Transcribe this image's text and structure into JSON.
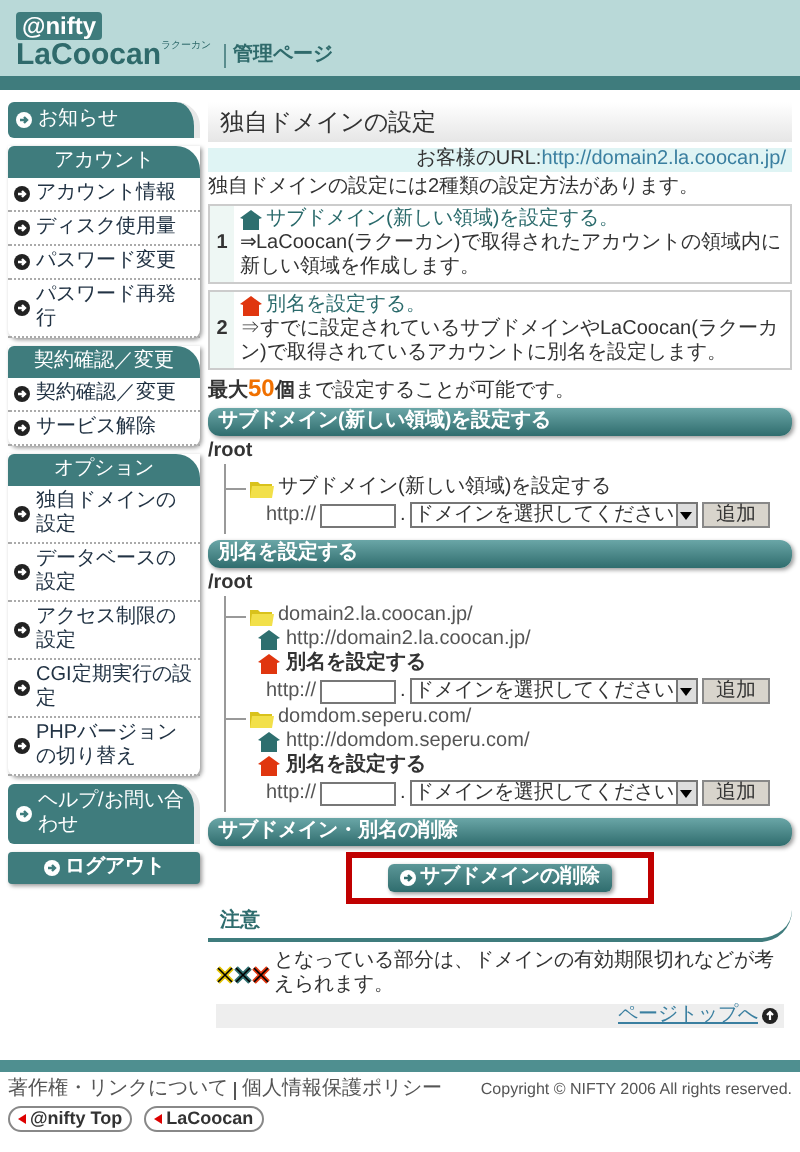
{
  "header": {
    "service": "@nifty",
    "logo": "LaCoocan",
    "logo_ruby": "ラクーカン",
    "title": "管理ページ"
  },
  "sidebar": [
    {
      "kind": "link",
      "label": "お知らせ"
    },
    {
      "kind": "group",
      "title": "アカウント",
      "items": [
        "アカウント情報",
        "ディスク使用量",
        "パスワード変更",
        "パスワード再発行"
      ]
    },
    {
      "kind": "group",
      "title": "契約確認／変更",
      "items": [
        "契約確認／変更",
        "サービス解除"
      ]
    },
    {
      "kind": "group",
      "title": "オプション",
      "items": [
        "独自ドメインの設定",
        "データベースの設定",
        "アクセス制限の設定",
        "CGI定期実行の設定",
        "PHPバージョンの切り替え"
      ]
    },
    {
      "kind": "link",
      "label": "ヘルプ/お問い合わせ"
    },
    {
      "kind": "button",
      "label": "ログアウト"
    }
  ],
  "main": {
    "title": "独自ドメインの設定",
    "url_label": "お客様のURL:",
    "url": "http://domain2.la.coocan.jp/",
    "intro": "独自ドメインの設定には2種類の設定方法があります。",
    "methods": [
      {
        "number": "1",
        "kind": "subdomain",
        "title": "サブドメイン(新しい領域)を設定する。",
        "description": "⇒LaCoocan(ラクーカン)で取得されたアカウントの領域内に新しい領域を作成します。"
      },
      {
        "number": "2",
        "kind": "alias",
        "title": "別名を設定する。",
        "description": "⇒すでに設定されているサブドメインやLaCoocan(ラクーカン)で取得されているアカウントに別名を設定します。"
      }
    ],
    "limit": {
      "before": "最大",
      "count": "50",
      "unit": "個",
      "after": "まで設定することが可能です。"
    },
    "subdomain_section": {
      "title": "サブドメイン(新しい領域)を設定する",
      "root": "/root",
      "label": "サブドメイン(新しい領域)を設定する",
      "prefix": "http://",
      "dot": ".",
      "select_value": "ドメインを選択してください",
      "button": "追加"
    },
    "alias_section": {
      "title": "別名を設定する",
      "root": "/root",
      "folders": [
        {
          "name": "domain2.la.coocan.jp/",
          "url": "http://domain2.la.coocan.jp/",
          "alias_label": "別名を設定する",
          "prefix": "http://",
          "dot": ".",
          "select_value": "ドメインを選択してください",
          "button": "追加"
        },
        {
          "name": "domdom.seperu.com/",
          "url": "http://domdom.seperu.com/",
          "alias_label": "別名を設定する",
          "prefix": "http://",
          "dot": ".",
          "select_value": "ドメインを選択してください",
          "button": "追加"
        }
      ]
    },
    "delete_section": {
      "title": "サブドメイン・別名の削除",
      "button": "サブドメインの削除",
      "highlighted": true
    },
    "notice": {
      "title": "注意",
      "text": "となっている部分は、ドメインの有効期限切れなどが考えられます。",
      "page_top": "ページトップへ"
    }
  },
  "footer": {
    "links": [
      "著作権・リンクについて",
      "個人情報保護ポリシー"
    ],
    "copyright": "Copyright © NIFTY 2006 All rights reserved.",
    "badges": [
      "@nifty Top",
      "LaCoocan"
    ]
  }
}
